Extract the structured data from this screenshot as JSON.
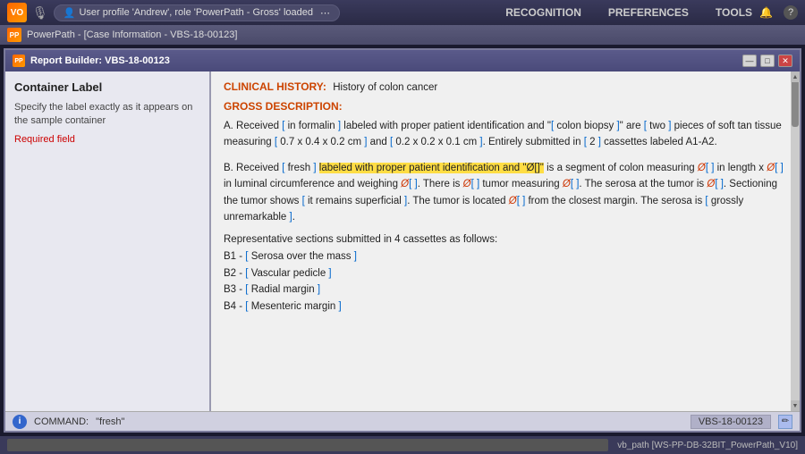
{
  "topbar": {
    "logo": "VO",
    "mic_label": "🎙",
    "user_badge": "User profile 'Andrew', role 'PowerPath - Gross' loaded",
    "more_icon": "⋯",
    "nav": [
      "RECOGNITION",
      "PREFERENCES",
      "TOOLS"
    ],
    "bell_icon": "🔔",
    "help_icon": "?"
  },
  "secondbar": {
    "logo": "PP",
    "title": "PowerPath - [Case Information - VBS-18-00123]"
  },
  "window": {
    "title": "Report Builder: VBS-18-00123",
    "minimize": "—",
    "maximize": "□",
    "close": "✕"
  },
  "left_panel": {
    "title": "Container Label",
    "desc": "Specify the label exactly as it appears on the sample container",
    "required": "Required field"
  },
  "right_panel": {
    "clinical_header": "CLINICAL HISTORY:",
    "clinical_text": "History of colon cancer",
    "gross_header": "GROSS DESCRIPTION:",
    "para_a_prefix": "A. Received",
    "para_a_formalin": "in formalin",
    "para_a_mid": "labeled with proper patient identification and \"",
    "para_a_biopsy": "colon biopsy",
    "para_a_rest": "\" are [ two ] pieces of soft tan tissue measuring [ 0.7 x 0.4 x 0.2 cm ] and [ 0.2 x 0.2 x 0.1 cm ]. Entirely submitted in [ 2 ] cassettes labeled A1-A2.",
    "para_b_prefix": "B. Received",
    "para_b_fresh": "fresh",
    "para_b_highlight_start": "labeled with proper patient identification and \"Ø[",
    "para_b_highlight_end": "]\"",
    "para_b_rest": "is a segment of colon measuring Ø[ ] in length x Ø[ ] in luminal circumference and weighing Ø[ ]. There is Ø[ ] tumor measuring Ø[ ]. The serosa at the tumor is Ø[ ]. Sectioning the tumor shows [ it remains superficial ]. The tumor is located Ø[ ] from the closest margin. The serosa is [ grossly unremarkable ].",
    "list_header": "Representative sections submitted in 4 cassettes as follows:",
    "list_items": [
      "B1 - [ Serosa over the mass ]",
      "B2 - [ Vascular pedicle ]",
      "B3 - [ Radial margin ]",
      "B4 - [ Mesenteric margin ]"
    ]
  },
  "statusbar": {
    "command_label": "COMMAND:",
    "command_value": "\"fresh\"",
    "case_id": "VBS-18-00123",
    "edit_icon": "✏"
  },
  "bottombar": {
    "path": "vb_path [WS-PP-DB-32BIT_PowerPath_V10]"
  }
}
